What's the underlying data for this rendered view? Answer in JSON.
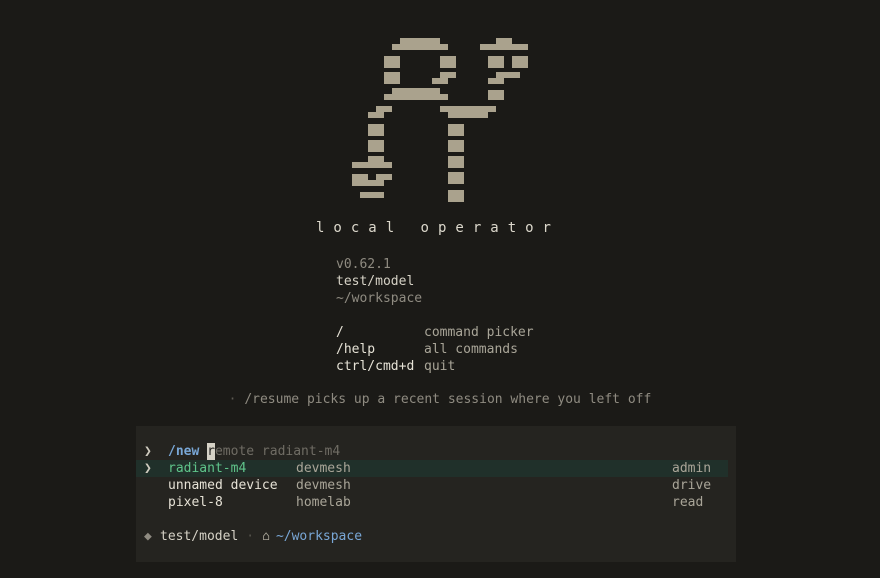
{
  "app": {
    "title": "local operator"
  },
  "info": {
    "version": "v0.62.1",
    "model": "test/model",
    "workspace": "~/workspace"
  },
  "commands": [
    {
      "key": "/",
      "desc": "command picker"
    },
    {
      "key": "/help",
      "desc": "all commands"
    },
    {
      "key": "ctrl/cmd+d",
      "desc": "quit"
    }
  ],
  "tip": {
    "bullet": "·",
    "text": "/resume picks up a recent session where you left off"
  },
  "input": {
    "prompt": "❯",
    "command": "/new",
    "cursor_char": "r",
    "ghost_text": "emote radiant-m4"
  },
  "devices": [
    {
      "marker": "❯",
      "name": "radiant-m4",
      "network": "devmesh",
      "role": "admin",
      "selected": true
    },
    {
      "marker": "",
      "name": "unnamed device",
      "network": "devmesh",
      "role": "drive",
      "selected": false
    },
    {
      "marker": "",
      "name": "pixel-8",
      "network": "homelab",
      "role": "read",
      "selected": false
    }
  ],
  "status": {
    "model_icon": "◆",
    "model": "test/model",
    "separator": "·",
    "home_icon": "⌂",
    "path": "~/workspace"
  },
  "colors": {
    "background": "#1b1a17",
    "panel": "#252420",
    "accent_blue": "#79a7d6",
    "accent_green": "#5fc48a",
    "logo": "#aaa28d"
  }
}
